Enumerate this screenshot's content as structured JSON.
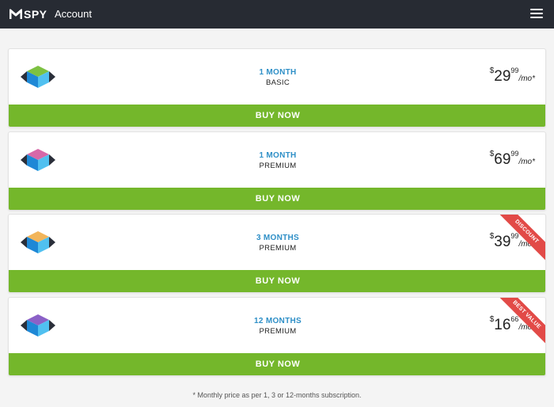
{
  "app": {
    "logo_text": "SPY",
    "title": "Account"
  },
  "plans": [
    {
      "duration": "1 MONTH",
      "tier": "BASIC",
      "currency": "$",
      "whole": "29",
      "cents": "99",
      "per": "/mo*",
      "button": "BUY NOW",
      "ribbon": "",
      "cube_top": "#7dc142"
    },
    {
      "duration": "1 MONTH",
      "tier": "PREMIUM",
      "currency": "$",
      "whole": "69",
      "cents": "99",
      "per": "/mo*",
      "button": "BUY NOW",
      "ribbon": "",
      "cube_top": "#d768a8"
    },
    {
      "duration": "3 MONTHS",
      "tier": "PREMIUM",
      "currency": "$",
      "whole": "39",
      "cents": "99",
      "per": "/mo*",
      "button": "BUY NOW",
      "ribbon": "DISCOUNT",
      "cube_top": "#f2b55a"
    },
    {
      "duration": "12 MONTHS",
      "tier": "PREMIUM",
      "currency": "$",
      "whole": "16",
      "cents": "66",
      "per": "/mo*",
      "button": "BUY NOW",
      "ribbon": "BEST VALUE",
      "cube_top": "#8b61c7"
    }
  ],
  "footnote": "* Monthly price as per 1, 3 or 12-months subscription.",
  "colors": {
    "topbar": "#272b33",
    "button": "#74b72b",
    "accent": "#2e8fc7",
    "ribbon": "#e24a47"
  }
}
